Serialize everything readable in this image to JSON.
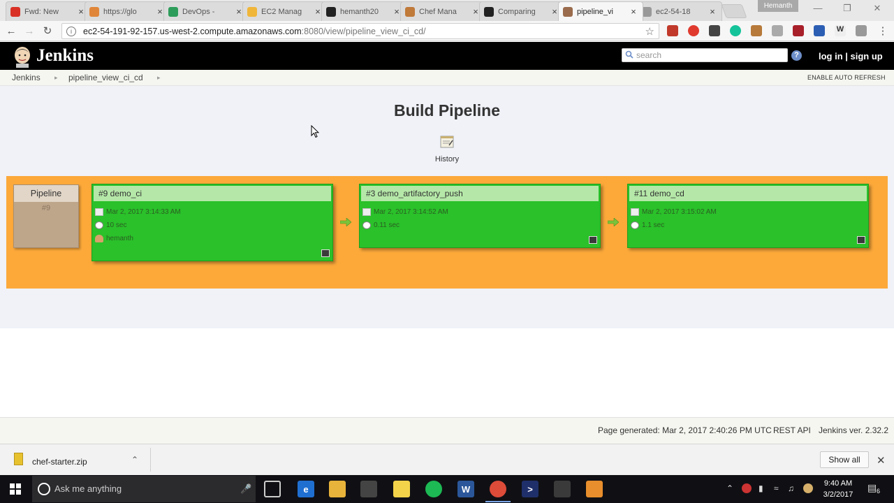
{
  "browser": {
    "tabs": [
      {
        "title": "Fwd: New",
        "icon": "gmail-icon",
        "color": "#d93025"
      },
      {
        "title": "https://glo",
        "icon": "web-icon",
        "color": "#e0863a"
      },
      {
        "title": "DevOps -",
        "icon": "drive-icon",
        "color": "#2e9d5b"
      },
      {
        "title": "EC2 Manag",
        "icon": "aws-icon",
        "color": "#f0b63a"
      },
      {
        "title": "hemanth20",
        "icon": "github-icon",
        "color": "#222222"
      },
      {
        "title": "Chef Mana",
        "icon": "chef-icon",
        "color": "#c07a3a"
      },
      {
        "title": "Comparing",
        "icon": "github-icon",
        "color": "#222222"
      },
      {
        "title": "pipeline_vi",
        "icon": "jenkins-icon",
        "color": "#9a6b4c",
        "active": true
      },
      {
        "title": "ec2-54-18",
        "icon": "page-icon",
        "color": "#999999"
      }
    ],
    "profile": "Hemanth",
    "url_host": "ec2-54-191-92-157.us-west-2.compute.amazonaws.com",
    "url_path": ":8080/view/pipeline_view_ci_cd/"
  },
  "jenkins": {
    "logo_text": "Jenkins",
    "search_placeholder": "search",
    "help_label": "?",
    "login_text": "log in | sign up",
    "breadcrumbs": [
      "Jenkins",
      "pipeline_view_ci_cd"
    ],
    "auto_refresh": "ENABLE AUTO REFRESH",
    "page_title": "Build Pipeline",
    "history_label": "History",
    "pipeline": {
      "label": "Pipeline",
      "number": "#9"
    },
    "builds": [
      {
        "title": "#9 demo_ci",
        "date": "Mar 2, 2017 3:14:33 AM",
        "duration": "10 sec",
        "user": "hemanth"
      },
      {
        "title": "#3 demo_artifactory_push",
        "date": "Mar 2, 2017 3:14:52 AM",
        "duration": "0.11 sec"
      },
      {
        "title": "#11 demo_cd",
        "date": "Mar 2, 2017 3:15:02 AM",
        "duration": "1.1 sec"
      }
    ],
    "footer": {
      "generated": "Page generated: Mar 2, 2017 2:40:26 PM UTC",
      "rest_api": "REST API",
      "version": "Jenkins ver. 2.32.2"
    },
    "colors": {
      "pipeline_bg": "#fca93a",
      "build_success": "#2ac12a",
      "build_header": "#b5e8a8"
    }
  },
  "downloads": {
    "file": "chef-starter.zip",
    "show_all": "Show all"
  },
  "taskbar": {
    "search_placeholder": "Ask me anything",
    "time": "9:40 AM",
    "date": "3/2/2017",
    "notification_count": "6"
  }
}
